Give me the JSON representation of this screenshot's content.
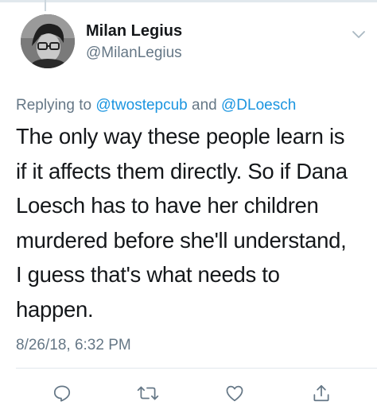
{
  "user": {
    "display_name": "Milan Legius",
    "handle": "@MilanLegius"
  },
  "reply_context": {
    "prefix": "Replying to",
    "conjunction": "and",
    "mentions": [
      "@twostepcub",
      "@DLoesch"
    ]
  },
  "tweet": {
    "lines": [
      "The only way these people learn is",
      "if it affects them directly. So if Dana",
      "Loesch has to have her children",
      "murdered before she'll understand,",
      "I guess that's what needs to",
      "happen."
    ],
    "timestamp": "8/26/18, 6:32 PM"
  },
  "actions": [
    {
      "name": "reply",
      "icon": "speech-bubble-icon"
    },
    {
      "name": "retweet",
      "icon": "retweet-arrows-icon"
    },
    {
      "name": "like",
      "icon": "heart-icon"
    },
    {
      "name": "share",
      "icon": "share-upload-icon"
    }
  ],
  "colors": {
    "text": "#14171a",
    "secondary": "#657786",
    "link": "#1b95e0",
    "icon": "#657786",
    "divider": "#e1e8ed"
  }
}
